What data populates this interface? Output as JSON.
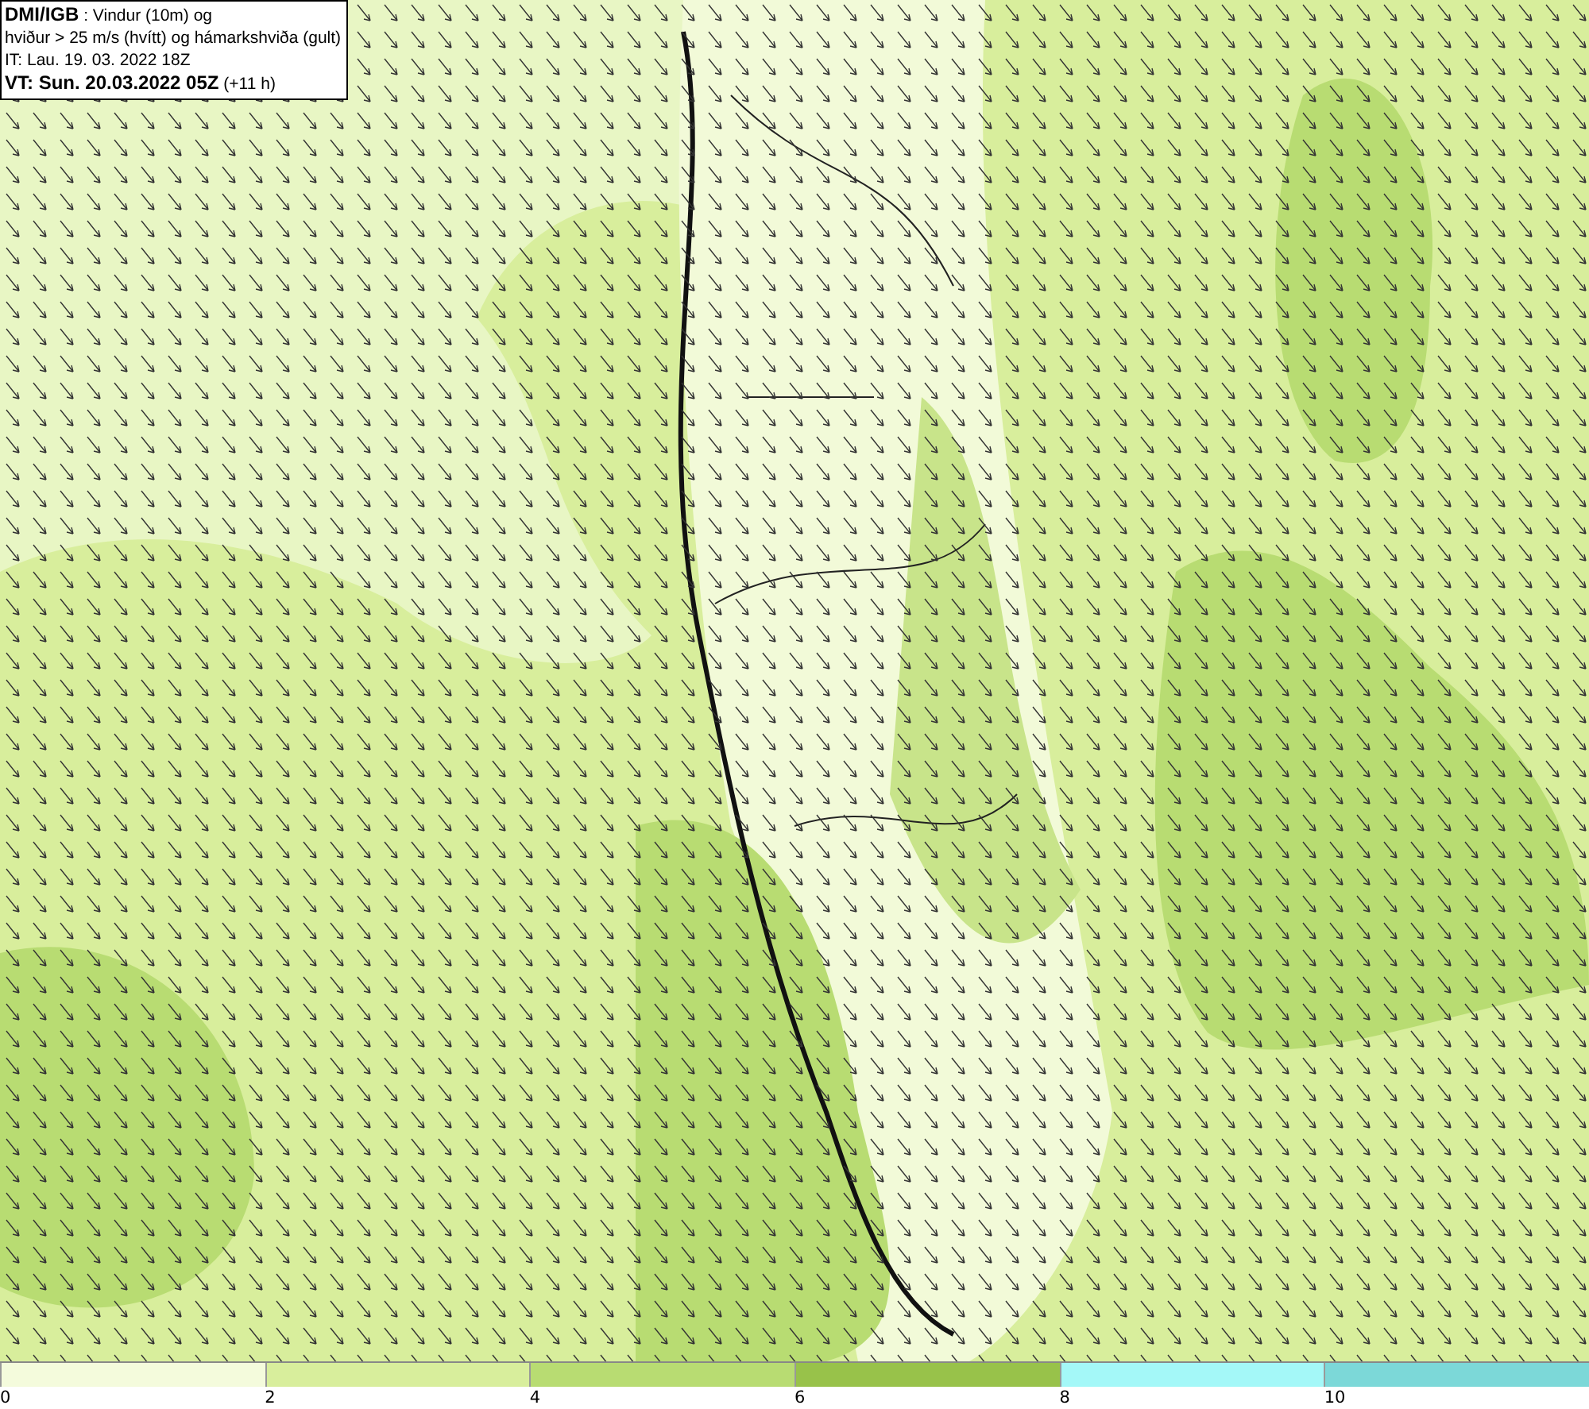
{
  "info_box": {
    "lines": [
      "**DMI/IGB** : Vindur (10m) og",
      "hviður > 25 m/s (hvítt) og hámarkshviða (gult)",
      "IT: Lau. 19. 03. 2022 18Z",
      "**VT: Sun. 20.03.2022 05Z** (+11 h)"
    ]
  },
  "legend": {
    "bins": [
      {
        "color": "#f4fbdc"
      },
      {
        "color": "#d8ee9c"
      },
      {
        "color": "#b8dc72"
      },
      {
        "color": "#98c24a"
      },
      {
        "color": "#a4f8f8"
      },
      {
        "color": "#7cd8d8"
      }
    ],
    "ticks": [
      "0",
      "2",
      "4",
      "6",
      "8",
      "10"
    ]
  }
}
